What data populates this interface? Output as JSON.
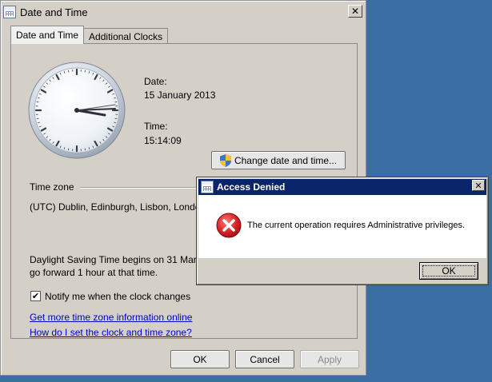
{
  "window": {
    "title": "Date and Time",
    "close_glyph": "✕",
    "icon": "date-time-app-icon"
  },
  "tabs": [
    {
      "label": "Date and Time",
      "active": true
    },
    {
      "label": "Additional Clocks",
      "active": false
    }
  ],
  "panel": {
    "date_label": "Date:",
    "date_value": "15 January 2013",
    "time_label": "Time:",
    "time_value": "15:14:09",
    "change_button_label": "Change date and time...",
    "change_button_icon": "uac-shield-icon",
    "timezone_heading": "Time zone",
    "timezone_value": "(UTC) Dublin, Edinburgh, Lisbon, London",
    "dst_line1": "Daylight Saving Time begins on 31 March",
    "dst_line2": "go forward 1 hour at that time.",
    "notify_label": "Notify me when the clock changes",
    "notify_checked": true,
    "link_more_info": "Get more time zone information online",
    "link_how_to": "How do I set the clock and time zone?"
  },
  "footer": {
    "ok_label": "OK",
    "cancel_label": "Cancel",
    "apply_label": "Apply",
    "apply_enabled": false
  },
  "dialog": {
    "title": "Access Denied",
    "close_glyph": "✕",
    "message": "The current operation requires Administrative privileges.",
    "ok_label": "OK",
    "icon": "error-icon"
  },
  "colors": {
    "desktop": "#3a6ea5",
    "dialog_titlebar": "#0a246a",
    "link": "#0000cc",
    "error_red": "#d9252a"
  }
}
